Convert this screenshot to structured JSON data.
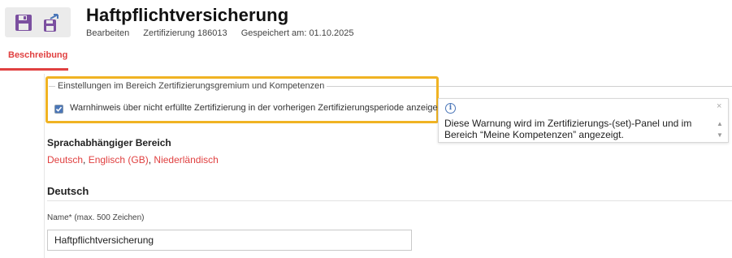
{
  "toolbar": {
    "save_icon": "floppy-disk-icon",
    "save_as_icon": "save-as-icon",
    "accent_color": "#7b4fa0"
  },
  "header": {
    "title": "Haftpflichtversicherung",
    "mode": "Bearbeiten",
    "certification": "Zertifizierung 186013",
    "saved": "Gespeichert am: 01.10.2025"
  },
  "tabs": [
    {
      "label": "Beschreibung",
      "active": true
    }
  ],
  "settings": {
    "legend": "Einstellungen im Bereich Zertifizierungsgremium und Kompetenzen",
    "checkbox_label": "Warnhinweis über nicht erfüllte Zertifizierung in der vorherigen Zertifizierungsperiode anzeigen",
    "checkbox_checked": true
  },
  "tooltip": {
    "icon": "info-icon",
    "close": "×",
    "up": "▲",
    "down": "▼",
    "text": "Diese Warnung wird im Zertifizierungs-(set)-Panel und im Bereich “Meine Kompetenzen” angezeigt."
  },
  "language_section": {
    "title": "Sprachabhängiger Bereich",
    "languages": [
      "Deutsch",
      "Englisch (GB)",
      "Niederländisch"
    ],
    "separator": ", ",
    "link_color": "#e04040"
  },
  "deutsch": {
    "title": "Deutsch",
    "name_label": "Name* (max. 500 Zeichen)",
    "name_value": "Haftpflichtversicherung"
  }
}
